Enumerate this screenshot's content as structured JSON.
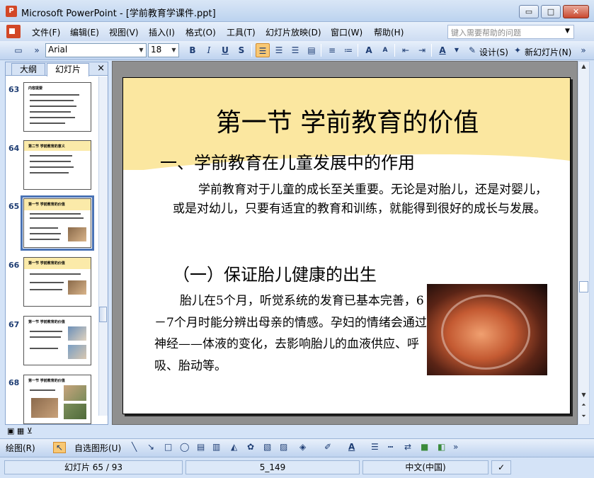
{
  "window": {
    "title": "Microsoft PowerPoint - [学前教育学课件.ppt]",
    "app_icon_letter": "P"
  },
  "window_controls": {
    "minimize": "▭",
    "maximize": "□",
    "close": "✕"
  },
  "menu": {
    "items": [
      "文件(F)",
      "编辑(E)",
      "视图(V)",
      "插入(I)",
      "格式(O)",
      "工具(T)",
      "幻灯片放映(D)",
      "窗口(W)",
      "帮助(H)"
    ],
    "help_placeholder": "键入需要帮助的问题"
  },
  "toolbar": {
    "font_name": "Arial",
    "font_size": "18",
    "bold": "B",
    "italic": "I",
    "underline": "U",
    "shadow": "S",
    "design_label": "设计(S)",
    "new_slide_label": "新幻灯片(N)"
  },
  "left_panel": {
    "tabs": [
      "大纲",
      "幻灯片"
    ],
    "active_tab": "幻灯片",
    "close": "×",
    "thumbnails": [
      {
        "number": "63",
        "title": "内容提要"
      },
      {
        "number": "64",
        "title": "第二节 学前教育的意义"
      },
      {
        "number": "65",
        "title": "第一节 学前教育的价值",
        "selected": true
      },
      {
        "number": "66",
        "title": "第一节 学前教育的价值"
      },
      {
        "number": "67",
        "title": "第一节 学前教育的价值"
      },
      {
        "number": "68",
        "title": "第一节 学前教育的价值"
      }
    ]
  },
  "slide": {
    "title": "第一节  学前教育的价值",
    "subtitle": "一、学前教育在儿童发展中的作用",
    "paragraph": "学前教育对于儿童的成长至关重要。无论是对胎儿，还是对婴儿，或是对幼儿，只要有适宜的教育和训练，就能得到很好的成长与发展。",
    "section_heading": "（一）保证胎儿健康的出生",
    "body": "胎儿在5个月，听觉系统的发育已基本完善，6－7个月时能分辨出母亲的情感。孕妇的情绪会通过神经——体液的变化，去影响胎儿的血液供应、呼吸、胎动等。"
  },
  "drawing_toolbar": {
    "draw_label": "绘图(R)",
    "autoshape_label": "自选图形(U)"
  },
  "status_bar": {
    "slide_info": "幻灯片 65 / 93",
    "design_name": "5_149",
    "language": "中文(中国)"
  }
}
